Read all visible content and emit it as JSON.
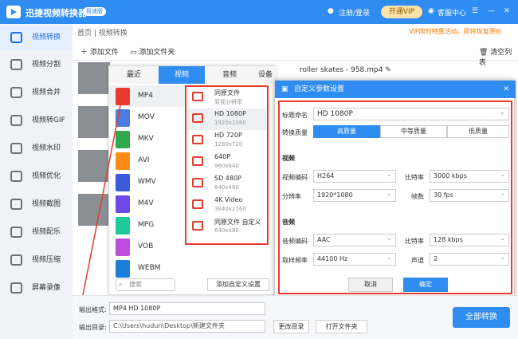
{
  "app": {
    "title": "迅捷视频转换器",
    "badge": "极速版",
    "login": "注册/登录",
    "vip": "开通VIP",
    "service": "客服中心"
  },
  "sidebar": {
    "items": [
      {
        "label": "视频转换"
      },
      {
        "label": "视频分割"
      },
      {
        "label": "视频合并"
      },
      {
        "label": "视频转GIF"
      },
      {
        "label": "视频水印"
      },
      {
        "label": "视频优化"
      },
      {
        "label": "视频截图"
      },
      {
        "label": "视频配乐"
      },
      {
        "label": "视频压缩"
      },
      {
        "label": "屏幕录像"
      }
    ]
  },
  "main": {
    "breadcrumb": "首页 | 视频转换",
    "promo": "VIP限时特惠活动，即将恢复原价",
    "add_file": "添加文件",
    "add_folder": "添加文件夹",
    "clear_list": "清空列表",
    "file_name": "roller skates - 958.mp4"
  },
  "format_panel": {
    "tabs": [
      "最近",
      "视频",
      "音频",
      "设备"
    ],
    "formats": [
      {
        "label": "MP4",
        "color": "#e63b2e"
      },
      {
        "label": "MOV",
        "color": "#4a7be0"
      },
      {
        "label": "MKV",
        "color": "#2fa84f"
      },
      {
        "label": "AVI",
        "color": "#ff8c1a"
      },
      {
        "label": "WMV",
        "color": "#3b5bdb"
      },
      {
        "label": "M4V",
        "color": "#7048e8"
      },
      {
        "label": "MPG",
        "color": "#20c997"
      },
      {
        "label": "VOB",
        "color": "#be4bdb"
      },
      {
        "label": "WEBM",
        "color": "#1c7ed6"
      }
    ],
    "qualities": [
      {
        "name": "同原文件",
        "res": "原视分辨率"
      },
      {
        "name": "HD 1080P",
        "res": "1920x1080"
      },
      {
        "name": "HD 720P",
        "res": "1280x720"
      },
      {
        "name": "640P",
        "res": "960x640"
      },
      {
        "name": "SD 480P",
        "res": "640x480"
      },
      {
        "name": "4K Video",
        "res": "3840x2160"
      },
      {
        "name": "同原文件 自定义",
        "res": "640x480"
      }
    ],
    "search_placeholder": "搜索",
    "add_custom": "添加自定义设置"
  },
  "dialog": {
    "title": "自定义参数设置",
    "name_label": "标题命名",
    "name_value": "HD 1080P",
    "quality_label": "转换质量",
    "quality_opts": [
      "高质量",
      "中等质量",
      "低质量"
    ],
    "video_section": "视频",
    "vcodec_label": "视频编码",
    "vcodec": "H264",
    "vbitrate_label": "比特率",
    "vbitrate": "3000 kbps",
    "res_label": "分辨率",
    "resolution": "1920*1080",
    "fps_label": "帧数",
    "fps": "30 fps",
    "audio_section": "音频",
    "acodec_label": "音频编码",
    "acodec": "AAC",
    "abitrate_label": "比特率",
    "abitrate": "128 kbps",
    "sample_label": "取样频率",
    "sample": "44100 Hz",
    "channel_label": "声道",
    "channels": "2",
    "cancel": "取消",
    "ok": "确定"
  },
  "bottom": {
    "format_label": "输出格式:",
    "format_value": "MP4  HD 1080P",
    "dir_label": "输出目录:",
    "dir_value": "C:\\Users\\hudun\\Desktop\\新建文件夹",
    "change_dir": "更改目录",
    "open_folder": "打开文件夹",
    "convert_all": "全部转换"
  }
}
